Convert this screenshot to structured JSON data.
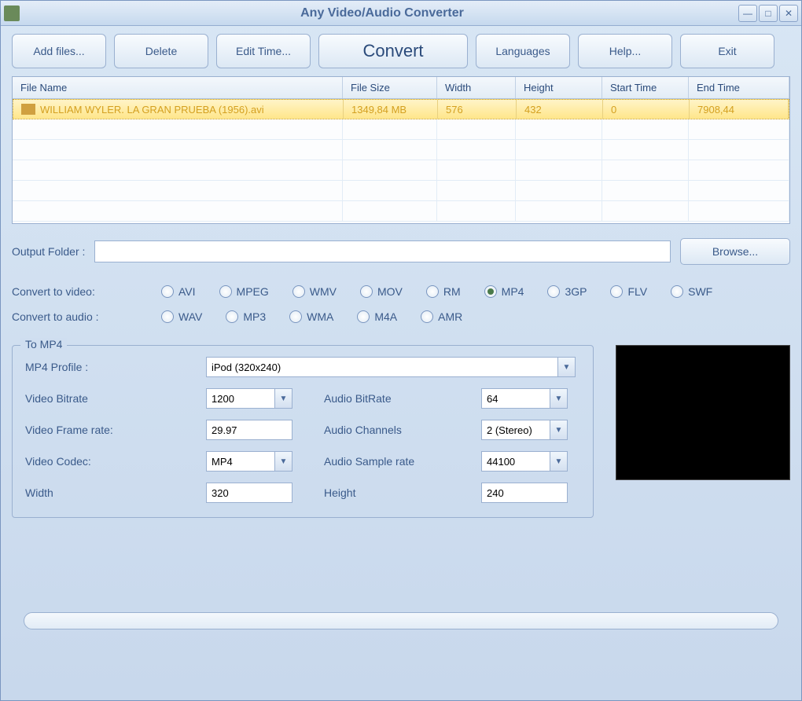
{
  "window": {
    "title": "Any Video/Audio Converter"
  },
  "toolbar": {
    "add_files": "Add files...",
    "delete": "Delete",
    "edit_time": "Edit Time...",
    "convert": "Convert",
    "languages": "Languages",
    "help": "Help...",
    "exit": "Exit"
  },
  "grid": {
    "headers": {
      "file_name": "File Name",
      "file_size": "File Size",
      "width": "Width",
      "height": "Height",
      "start_time": "Start Time",
      "end_time": "End Time"
    },
    "rows": [
      {
        "file_name": "WILLIAM WYLER. LA GRAN PRUEBA (1956).avi",
        "file_size": "1349,84 MB",
        "width": "576",
        "height": "432",
        "start_time": "0",
        "end_time": "7908,44"
      }
    ]
  },
  "output": {
    "label": "Output Folder :",
    "value": "",
    "browse": "Browse..."
  },
  "convert_video": {
    "label": "Convert to video:",
    "options": [
      "AVI",
      "MPEG",
      "WMV",
      "MOV",
      "RM",
      "MP4",
      "3GP",
      "FLV",
      "SWF"
    ],
    "selected": "MP4"
  },
  "convert_audio": {
    "label": "Convert to audio :",
    "options": [
      "WAV",
      "MP3",
      "WMA",
      "M4A",
      "AMR"
    ],
    "selected": ""
  },
  "settings": {
    "legend": "To MP4",
    "profile_label": "MP4 Profile :",
    "profile_value": "iPod (320x240)",
    "video_bitrate_label": "Video Bitrate",
    "video_bitrate_value": "1200",
    "audio_bitrate_label": "Audio BitRate",
    "audio_bitrate_value": "64",
    "video_framerate_label": "Video Frame rate:",
    "video_framerate_value": "29.97",
    "audio_channels_label": "Audio Channels",
    "audio_channels_value": "2 (Stereo)",
    "video_codec_label": "Video Codec:",
    "video_codec_value": "MP4",
    "audio_samplerate_label": "Audio Sample rate",
    "audio_samplerate_value": "44100",
    "width_label": "Width",
    "width_value": "320",
    "height_label": "Height",
    "height_value": "240"
  }
}
